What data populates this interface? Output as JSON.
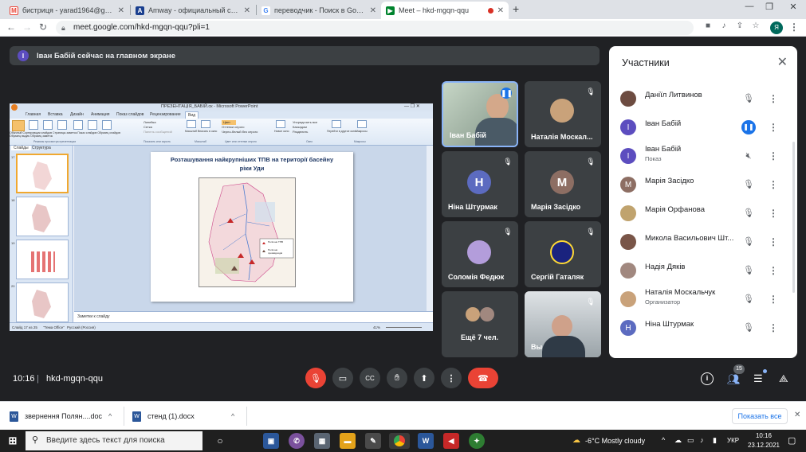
{
  "browser": {
    "tabs": [
      {
        "title": "бистриця - yarad1964@gmail.co",
        "favicon": "M",
        "color": "#ea4335"
      },
      {
        "title": "Amway - официальный сайт и и",
        "favicon": "A",
        "color": "#1a3f8f"
      },
      {
        "title": "переводчик - Поиск в Google",
        "favicon": "G",
        "color": "#4285f4"
      },
      {
        "title": "Meet – hkd-mgqn-qqu",
        "favicon": "▶",
        "color": "#00832d"
      }
    ],
    "new_tab": "+",
    "url": "meet.google.com/hkd-mgqn-qqu?pli=1",
    "profile_initial": "Я"
  },
  "banner": {
    "initial": "І",
    "text": "Іван Бабій сейчас на главном экране"
  },
  "presentation": {
    "window_title": "ПРЕЗЕНТАЦІЯ_БАБІЙ.ск - Microsoft PowerPoint",
    "ribbon_tabs": [
      "Главная",
      "Вставка",
      "Дизайн",
      "Анимация",
      "Показ слайдов",
      "Рецензирование",
      "Вид"
    ],
    "ribbon_groups": [
      "Режимы просмотра презентации",
      "Показать или скрыть",
      "Масштаб",
      "Цвет или оттенки серого",
      "Окно",
      "Макросы"
    ],
    "ribbon_items": [
      "Обычный",
      "Сортировщик слайдов",
      "Страницы заметок",
      "Показ слайдов",
      "Образец слайдов",
      "Образец выдач",
      "Образец заметок",
      "Линейка",
      "Сетка",
      "Панель сообщений",
      "Масштаб",
      "Вписать в окно",
      "Цвет",
      "Оттенки серого",
      "Черно-белый без серого",
      "Новое окно",
      "Упорядочить все",
      "Каскадом",
      "Разделить",
      "Перейти в другое окно",
      "Макросы"
    ],
    "panel_tabs": [
      "Слайды",
      "Структура"
    ],
    "slide_numbers": [
      "17",
      "18",
      "19",
      "20"
    ],
    "slide_title": "Розташування найкрупніших ТПВ на території басейну ріки Уди",
    "legend": [
      "Полігони ТПВ",
      "Полігони промвідходів"
    ],
    "notes": "Заметки к слайду",
    "status": [
      "Слайд 17 из 25",
      "\"Тема Office\"",
      "Русский (Россия)"
    ],
    "zoom": "41%"
  },
  "tiles": [
    {
      "name": "Іван Бабій",
      "type": "video",
      "speaking": true
    },
    {
      "name": "Наталія Москал...",
      "type": "photo",
      "avatar_color": "#c9a27a"
    },
    {
      "name": "Ніна Штурмак",
      "type": "initial",
      "initial": "Н",
      "avatar_color": "#5c6bc0"
    },
    {
      "name": "Марія Засідко",
      "type": "initial",
      "initial": "М",
      "avatar_color": "#8d6e63"
    },
    {
      "name": "Соломія Федюк",
      "type": "photo",
      "avatar_color": "#b39ddb"
    },
    {
      "name": "Сергій Гаталяк",
      "type": "photo",
      "avatar_color": "#1a237e"
    },
    {
      "name": "Ещё 7 чел.",
      "type": "group"
    },
    {
      "name": "Вы",
      "type": "video"
    }
  ],
  "bottom": {
    "time": "10:16",
    "meeting_code": "hkd-mgqn-qqu",
    "people_count": "15"
  },
  "panel": {
    "title": "Участники",
    "participants": [
      {
        "name": "Даніїл Литвинов",
        "sub": "",
        "initial": "",
        "color": "#6d4c41",
        "mic": "muted"
      },
      {
        "name": "Іван Бабій",
        "sub": "",
        "initial": "І",
        "color": "#5c4dbf",
        "mic": "speaking"
      },
      {
        "name": "Іван Бабій",
        "sub": "Показ",
        "initial": "І",
        "color": "#5c4dbf",
        "mic": "presenting"
      },
      {
        "name": "Марія Засідко",
        "sub": "",
        "initial": "М",
        "color": "#8d6e63",
        "mic": "muted"
      },
      {
        "name": "Марія Орфанова",
        "sub": "",
        "initial": "",
        "color": "#c0a36e",
        "mic": "muted"
      },
      {
        "name": "Микола Васильович Шт...",
        "sub": "",
        "initial": "",
        "color": "#795548",
        "mic": "muted"
      },
      {
        "name": "Надія Дяків",
        "sub": "",
        "initial": "",
        "color": "#a1887f",
        "mic": "muted"
      },
      {
        "name": "Наталія Москальчук",
        "sub": "Организатор",
        "initial": "",
        "color": "#c9a27a",
        "mic": "muted"
      },
      {
        "name": "Ніна Штурмак",
        "sub": "",
        "initial": "Н",
        "color": "#5c6bc0",
        "mic": "muted"
      }
    ]
  },
  "downloads": {
    "items": [
      "звернення Полян....doc",
      "стенд (1).docx"
    ],
    "show_all": "Показать все"
  },
  "taskbar": {
    "search_placeholder": "Введите здесь текст для поиска",
    "weather": "-6°C  Mostly cloudy",
    "lang": "УКР",
    "time": "10:16",
    "date": "23.12.2021"
  }
}
